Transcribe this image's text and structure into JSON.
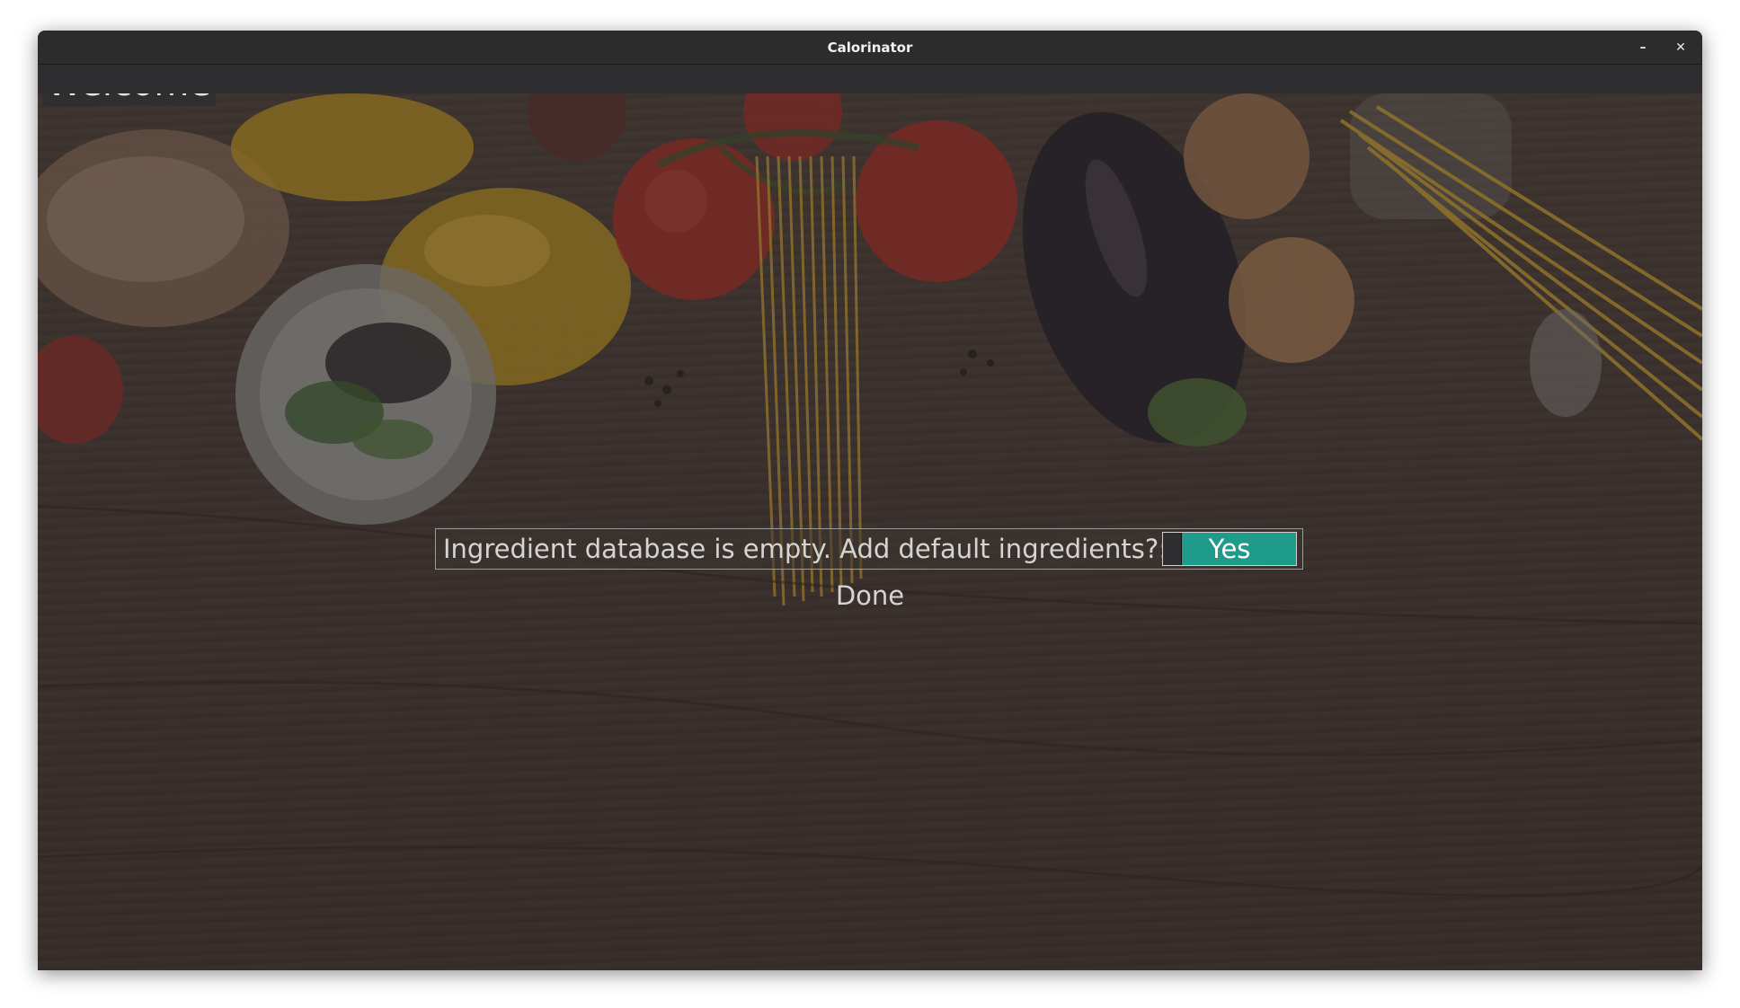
{
  "window": {
    "title": "Calorinator",
    "minimize_glyph": "–",
    "close_glyph": "✕"
  },
  "page": {
    "heading": "Welcome"
  },
  "setup": {
    "prompt": "Ingredient database is empty. Add default ingredients?:",
    "toggle_label": "Yes",
    "toggle_state": "on",
    "done_label": "Done"
  },
  "colors": {
    "toggle_accent": "#1e9b8a",
    "titlebar": "#2c2c2c"
  }
}
